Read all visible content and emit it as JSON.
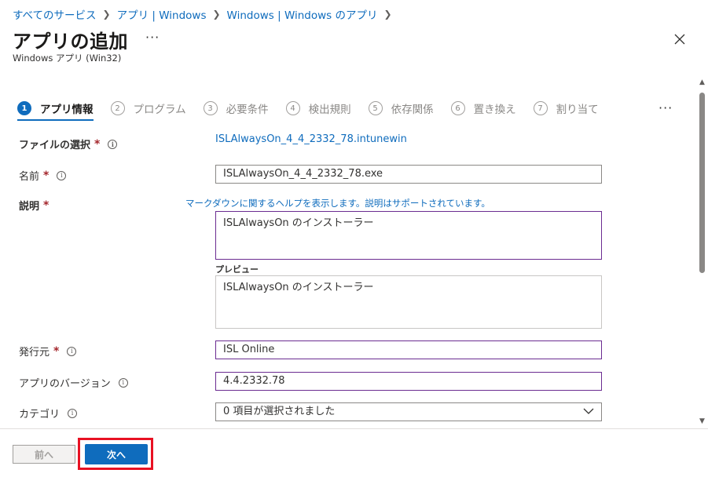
{
  "breadcrumb": [
    "すべてのサービス",
    "アプリ | Windows",
    "Windows | Windows のアプリ"
  ],
  "header": {
    "title": "アプリの追加",
    "more": "···",
    "subtitle": "Windows アプリ (Win32)"
  },
  "steps": [
    {
      "num": "1",
      "label": "アプリ情報",
      "active": true
    },
    {
      "num": "2",
      "label": "プログラム",
      "active": false
    },
    {
      "num": "3",
      "label": "必要条件",
      "active": false
    },
    {
      "num": "4",
      "label": "検出規則",
      "active": false
    },
    {
      "num": "5",
      "label": "依存関係",
      "active": false
    },
    {
      "num": "6",
      "label": "置き換え",
      "active": false
    },
    {
      "num": "7",
      "label": "割り当て",
      "active": false
    }
  ],
  "steps_more": "···",
  "form": {
    "file_label": "ファイルの選択",
    "file_value": "ISLAlwaysOn_4_4_2332_78.intunewin",
    "name_label": "名前",
    "name_value": "ISLAlwaysOn_4_4_2332_78.exe",
    "desc_label": "説明",
    "desc_help": "マークダウンに関するヘルプを表示します。説明はサポートされています。",
    "desc_value": "ISLAlwaysOn のインストーラー",
    "preview_label": "プレビュー",
    "preview_value": "ISLAlwaysOn のインストーラー",
    "publisher_label": "発行元",
    "publisher_value": "ISL Online",
    "version_label": "アプリのバージョン",
    "version_value": "4.4.2332.78",
    "category_label": "カテゴリ",
    "category_value": "0 項目が選択されました"
  },
  "footer": {
    "prev_label": "前へ",
    "next_label": "次へ"
  },
  "required_mark": "*",
  "info_glyph": "i",
  "colors": {
    "accent": "#0f6cbd",
    "required": "#a4262c",
    "focus_border": "#6b2c91",
    "highlight": "#e81123"
  },
  "icons": [
    "chevron-right-icon",
    "close-icon",
    "info-icon",
    "chevron-down-icon",
    "scroll-up-icon",
    "scroll-down-icon"
  ]
}
